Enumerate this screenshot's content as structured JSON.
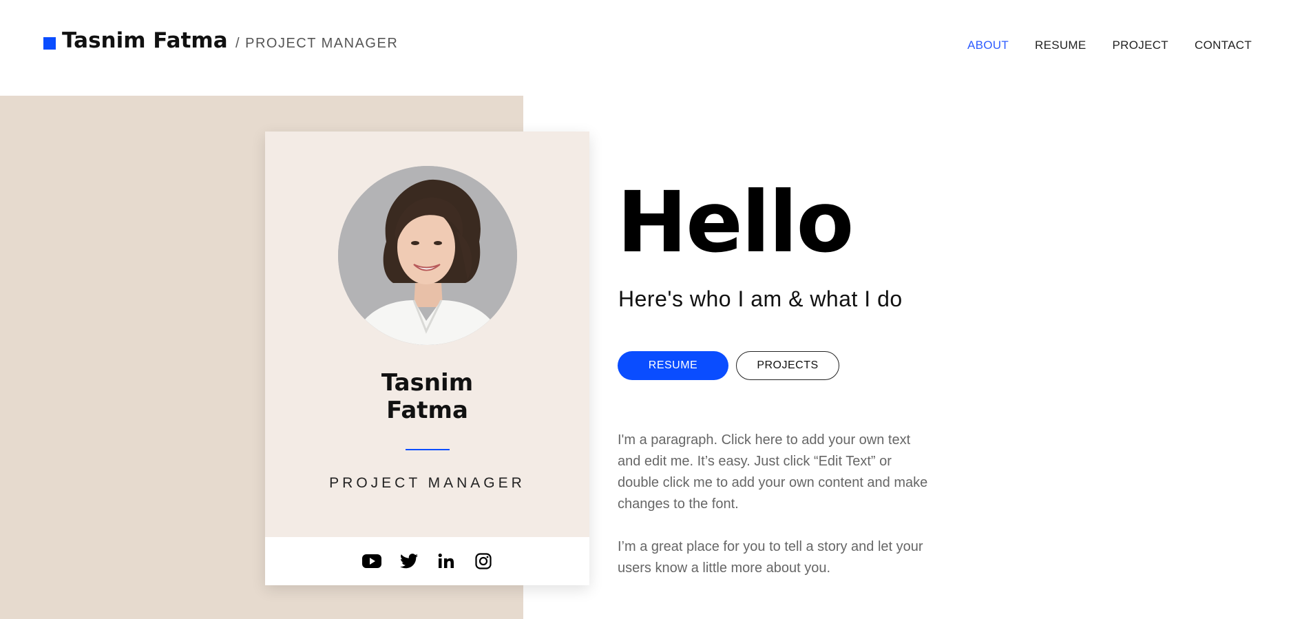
{
  "header": {
    "brand_name": "Tasnim Fatma",
    "brand_role": "/ PROJECT MANAGER",
    "nav": [
      {
        "label": "ABOUT",
        "active": true
      },
      {
        "label": "RESUME",
        "active": false
      },
      {
        "label": "PROJECT",
        "active": false
      },
      {
        "label": "CONTACT",
        "active": false
      }
    ]
  },
  "card": {
    "name_line1": "Tasnim",
    "name_line2": "Fatma",
    "title": "PROJECT MANAGER",
    "social": [
      "youtube-icon",
      "twitter-icon",
      "linkedin-icon",
      "instagram-icon"
    ]
  },
  "main": {
    "heading": "Hello",
    "subtitle": "Here's who I am & what I do",
    "buttons": {
      "resume": "RESUME",
      "projects": "PROJECTS"
    },
    "paragraph_1": "I'm a paragraph. Click here to add your own text and edit me. It’s easy. Just click “Edit Text” or double click me to add your own content and make changes to the font.",
    "paragraph_2": "I’m a great place for you to tell a story and let your users know a little more about you."
  },
  "colors": {
    "accent": "#0a4dff",
    "nav_active": "#2e5cff",
    "panel_beige": "#e6dace",
    "card_bg": "#f3ebe5"
  }
}
